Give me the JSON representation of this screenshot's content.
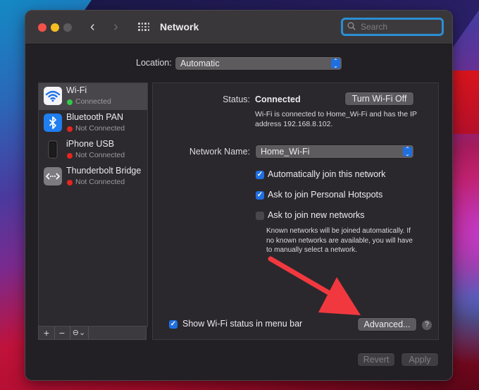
{
  "window": {
    "title": "Network",
    "search_placeholder": "Search",
    "accent_color": "#1f6fe0",
    "focus_ring_color": "#2b8ed3"
  },
  "location": {
    "label": "Location:",
    "value": "Automatic"
  },
  "sidebar": {
    "services": [
      {
        "name": "Wi-Fi",
        "status": "Connected",
        "status_color": "#34c84a",
        "icon": "wifi-icon",
        "selected": true
      },
      {
        "name": "Bluetooth PAN",
        "status": "Not Connected",
        "status_color": "#e5251f",
        "icon": "bluetooth-icon",
        "selected": false
      },
      {
        "name": "iPhone USB",
        "status": "Not Connected",
        "status_color": "#e5251f",
        "icon": "iphone-icon",
        "selected": false
      },
      {
        "name": "Thunderbolt Bridge",
        "status": "Not Connected",
        "status_color": "#e5251f",
        "icon": "thunderbolt-bridge-icon",
        "selected": false
      }
    ],
    "toolbar": {
      "add_label": "+",
      "remove_label": "−",
      "action_label": "⊖⌄"
    }
  },
  "detail": {
    "status_label": "Status:",
    "status_value": "Connected",
    "turn_off_label": "Turn Wi-Fi Off",
    "status_description": "Wi-Fi is connected to Home_Wi-Fi and has the IP address 192.168.8.102.",
    "network_name_label": "Network Name:",
    "network_name_value": "Home_Wi-Fi",
    "options": [
      {
        "label": "Automatically join this network",
        "checked": true
      },
      {
        "label": "Ask to join Personal Hotspots",
        "checked": true
      },
      {
        "label": "Ask to join new networks",
        "checked": false
      }
    ],
    "join_help": "Known networks will be joined automatically. If no known networks are available, you will have to manually select a network.",
    "show_status_label": "Show Wi-Fi status in menu bar",
    "show_status_checked": true,
    "advanced_label": "Advanced...",
    "help_label": "?"
  },
  "footer": {
    "revert_label": "Revert",
    "apply_label": "Apply"
  },
  "annotation": {
    "arrow_color": "#f2383f",
    "points_to": "Advanced..."
  }
}
